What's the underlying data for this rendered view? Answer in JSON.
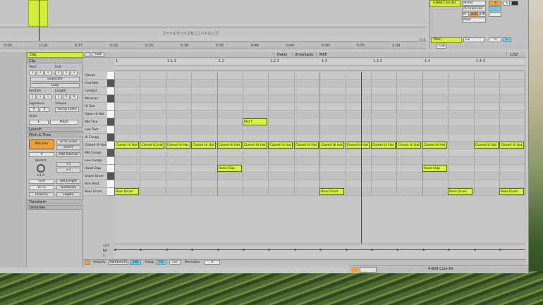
{
  "arrangement": {
    "device_path_label": "ファイルデバイスをここへドロップ",
    "ruler_labels": [
      "0:05",
      "0:10",
      "0:15",
      "0:20",
      "0:25",
      "0:30",
      "0:35",
      "0:40",
      "0:45",
      "0:50",
      "0:55",
      "1:00"
    ],
    "page_indicator": "1/2"
  },
  "mixer": {
    "track_name": "4-808 Core Kit",
    "input_type": "All Ins",
    "input_channel": "All Channels",
    "monitor": "Auto",
    "output": "Main",
    "track_number": "4",
    "solo_label": "S",
    "main_label": "Main",
    "main_page": "1/2",
    "mon_in": "In",
    "mon_auto": "Auto",
    "mon_off": "Off",
    "cue": "Cue",
    "vol_zero": "0",
    "pan_c": "C"
  },
  "clip_panel": {
    "title": "Clip",
    "clip_section": "Clip",
    "start_label": "Start",
    "end_label": "End",
    "start_vals": [
      "1",
      "1",
      "1"
    ],
    "end_vals": [
      "2",
      "1",
      "1"
    ],
    "duplicate": "Duplicate",
    "loop": "Loop",
    "position_label": "Position",
    "length_label": "Length",
    "position_vals": [
      "1",
      "1",
      "1"
    ],
    "length_vals": [
      "1",
      "0",
      "0"
    ],
    "signature_label": "Signature",
    "groove_label": "Groove",
    "sig_num": "4",
    "sig_den": "4",
    "groove_val": "Swing 16ths",
    "scale_label": "Scale",
    "scale_root": "E",
    "scale_name": "Major",
    "launch": "Launch",
    "pitch_time": "Pitch & Time",
    "note_name": "Mid Tom",
    "fit_to_scale": "Fit to Scale",
    "invert": "Invert",
    "add_interval": "Add Interval",
    "interval_val": "0",
    "stretch": "Stretch",
    "stretch_val": "×1.0",
    "half": "÷2",
    "double": "×2",
    "grid": "Grid",
    "set_length": "Set Length",
    "humanize_pct": "10 %",
    "humanize": "Humanize",
    "reverse": "Reverse",
    "legato": "Legato",
    "transform": "Transform",
    "generate": "Generate"
  },
  "editor": {
    "fold_label": "Fold",
    "tabs": [
      "Notes",
      "Envelopes",
      "MPE"
    ],
    "zoom": "1/32",
    "bar_labels": [
      "1",
      "1.1.3",
      "1.2",
      "1.2.3",
      "1.3",
      "1.3.3",
      "1.4",
      "1.4.3"
    ],
    "rows": [
      "Claves",
      "Cow Bell",
      "Cymbal",
      "Maracas",
      "Hi Tom",
      "Open Hi Hat",
      "Mid Tom",
      "Low Tom",
      "Hi Conga",
      "Closed Hi Hat",
      "Mid Conga",
      "Low Conga",
      "Hand Clap",
      "Snare Drum",
      "Rim Shot",
      "Bass Drum"
    ],
    "notes": [
      {
        "label": "Mid T",
        "row": 6,
        "col": 5
      },
      {
        "label": "Closed Hi Hat",
        "row": 9,
        "col": 0
      },
      {
        "label": "Closed Hi Hat",
        "row": 9,
        "col": 1
      },
      {
        "label": "Closed Hi Hat",
        "row": 9,
        "col": 2
      },
      {
        "label": "Closed Hi Hat",
        "row": 9,
        "col": 3
      },
      {
        "label": "Closed Hi Hat",
        "row": 9,
        "col": 4
      },
      {
        "label": "Closed Hi Hat",
        "row": 9,
        "col": 5
      },
      {
        "label": "Closed Hi Hat",
        "row": 9,
        "col": 6
      },
      {
        "label": "Closed Hi Hat",
        "row": 9,
        "col": 7
      },
      {
        "label": "Closed Hi Hat",
        "row": 9,
        "col": 8
      },
      {
        "label": "Closed Hi Hat",
        "row": 9,
        "col": 9
      },
      {
        "label": "Closed Hi Hat",
        "row": 9,
        "col": 10
      },
      {
        "label": "Closed Hi Hat",
        "row": 9,
        "col": 11
      },
      {
        "label": "Closed Hi Hat",
        "row": 9,
        "col": 12
      },
      {
        "label": "Closed Hi Hat",
        "row": 9,
        "col": 14
      },
      {
        "label": "Closed Hi Hat",
        "row": 9,
        "col": 15
      },
      {
        "label": "Hand Clap",
        "row": 12,
        "col": 4
      },
      {
        "label": "Hand Clap",
        "row": 12,
        "col": 12
      },
      {
        "label": "Bass Drum",
        "row": 15,
        "col": 0
      },
      {
        "label": "Bass Drum",
        "row": 15,
        "col": 8
      },
      {
        "label": "Bass Drum",
        "row": 15,
        "col": 13
      },
      {
        "label": "Bass Drum",
        "row": 15,
        "col": 15
      }
    ],
    "vel_scale": [
      "127",
      "64",
      "1"
    ]
  },
  "velocity_bar": {
    "velocity_label": "Velocity",
    "randomize": "Randomize",
    "vel_val": "100",
    "ramp": "Ramp",
    "ramp_from": "97",
    "ramp_to": "127",
    "deviation": "Deviation",
    "dev_val": "0"
  },
  "status": {
    "track": "4-808 Core Kit"
  }
}
